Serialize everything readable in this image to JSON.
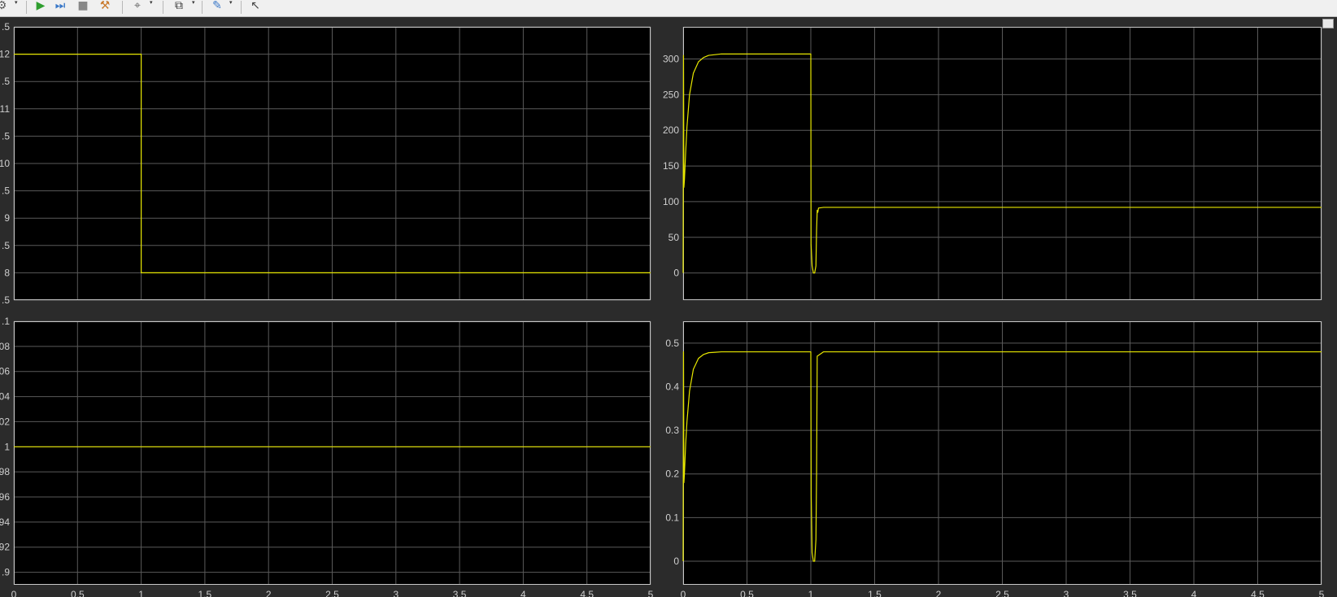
{
  "toolbar": {
    "buttons": [
      {
        "name": "settings-icon",
        "glyph": "⚙"
      },
      {
        "name": "run-icon",
        "glyph": "▶"
      },
      {
        "name": "step-forward-icon",
        "glyph": "⏭"
      },
      {
        "name": "stop-icon",
        "glyph": "■"
      },
      {
        "name": "highlight-icon",
        "glyph": "⚒"
      },
      {
        "name": "signal-selector-icon",
        "glyph": "⌖"
      },
      {
        "name": "zoom-fit-icon",
        "glyph": "⧉"
      },
      {
        "name": "style-icon",
        "glyph": "✎"
      },
      {
        "name": "measurement-icon",
        "glyph": "↖"
      }
    ]
  },
  "colors": {
    "axes_background": "#000000",
    "figure_background": "#2b2b2b",
    "trace": "#e6e600",
    "grid": "#5a5a5a",
    "tick_text": "#cfcfcf"
  },
  "chart_data": [
    {
      "type": "line",
      "position": "top-left",
      "xlim": [
        0,
        5
      ],
      "ylim": [
        7.5,
        12.5
      ],
      "yticks": [
        7.5,
        8,
        8.5,
        9,
        9.5,
        10,
        10.5,
        11,
        11.5,
        12,
        12.5
      ],
      "ytick_labels": [
        ".5",
        "8",
        ".5",
        "9",
        ".5",
        "10",
        ".5",
        "11",
        ".5",
        "12",
        ".5"
      ],
      "xticks": [
        0,
        0.5,
        1,
        1.5,
        2,
        2.5,
        3,
        3.5,
        4,
        4.5,
        5
      ],
      "xtick_labels": [],
      "grid": true,
      "series": [
        {
          "x": [
            0,
            1,
            1,
            5
          ],
          "y": [
            12,
            12,
            8,
            8
          ]
        }
      ]
    },
    {
      "type": "line",
      "position": "top-right",
      "xlim": [
        0,
        5
      ],
      "ylim": [
        -38,
        345
      ],
      "yticks": [
        0,
        50,
        100,
        150,
        200,
        250,
        300
      ],
      "ytick_labels": [
        "0",
        "50",
        "100",
        "150",
        "200",
        "250",
        "300"
      ],
      "xticks": [
        0,
        0.5,
        1,
        1.5,
        2,
        2.5,
        3,
        3.5,
        4,
        4.5,
        5
      ],
      "xtick_labels": [],
      "grid": true,
      "series": [
        {
          "x": [
            0,
            0.003,
            0.006,
            0.01,
            0.02,
            0.03,
            0.05,
            0.08,
            0.12,
            0.16,
            0.2,
            0.25,
            0.3,
            0.4,
            1.0,
            1.002,
            1.01,
            1.02,
            1.03,
            1.04,
            1.045,
            1.05,
            1.055,
            1.06,
            1.1,
            1.2,
            2,
            5
          ],
          "y": [
            0,
            305,
            120,
            130,
            170,
            205,
            250,
            280,
            296,
            302,
            305,
            306,
            307,
            307,
            307,
            40,
            10,
            0,
            0,
            10,
            60,
            88,
            85,
            91,
            92,
            92,
            92,
            92
          ]
        }
      ]
    },
    {
      "type": "line",
      "position": "bottom-left",
      "xlim": [
        0,
        5
      ],
      "ylim": [
        0.89,
        1.1
      ],
      "yticks": [
        0.9,
        0.92,
        0.94,
        0.96,
        0.98,
        1,
        1.02,
        1.04,
        1.06,
        1.08,
        1.1
      ],
      "ytick_labels": [
        ".9",
        "92",
        "94",
        "96",
        "98",
        "1",
        "02",
        "04",
        "06",
        "08",
        ".1"
      ],
      "xticks": [
        0,
        0.5,
        1,
        1.5,
        2,
        2.5,
        3,
        3.5,
        4,
        4.5,
        5
      ],
      "xtick_labels": [
        "0",
        "0.5",
        "1",
        "1.5",
        "2",
        "2.5",
        "3",
        "3.5",
        "4",
        "4.5",
        "5"
      ],
      "grid": true,
      "series": [
        {
          "x": [
            0,
            5
          ],
          "y": [
            1,
            1
          ]
        }
      ]
    },
    {
      "type": "line",
      "position": "bottom-right",
      "xlim": [
        0,
        5
      ],
      "ylim": [
        -0.054,
        0.55
      ],
      "yticks": [
        0,
        0.1,
        0.2,
        0.3,
        0.4,
        0.5
      ],
      "ytick_labels": [
        "0",
        "0.1",
        "0.2",
        "0.3",
        "0.4",
        "0.5"
      ],
      "xticks": [
        0,
        0.5,
        1,
        1.5,
        2,
        2.5,
        3,
        3.5,
        4,
        4.5,
        5
      ],
      "xtick_labels": [
        "0",
        "0.5",
        "1",
        "1.5",
        "2",
        "2.5",
        "3",
        "3.5",
        "4",
        "4.5",
        "5"
      ],
      "grid": true,
      "series": [
        {
          "x": [
            0,
            0.003,
            0.006,
            0.01,
            0.02,
            0.03,
            0.05,
            0.08,
            0.12,
            0.16,
            0.2,
            0.25,
            0.3,
            0.4,
            1.0,
            1.003,
            1.01,
            1.02,
            1.03,
            1.04,
            1.045,
            1.05,
            1.06,
            1.1,
            1.2,
            2,
            5
          ],
          "y": [
            0,
            0.48,
            0.18,
            0.2,
            0.27,
            0.32,
            0.39,
            0.44,
            0.465,
            0.474,
            0.478,
            0.479,
            0.48,
            0.48,
            0.48,
            0.15,
            0.02,
            0,
            0,
            0.05,
            0.2,
            0.47,
            0.472,
            0.48,
            0.48,
            0.48,
            0.48
          ]
        }
      ]
    }
  ]
}
